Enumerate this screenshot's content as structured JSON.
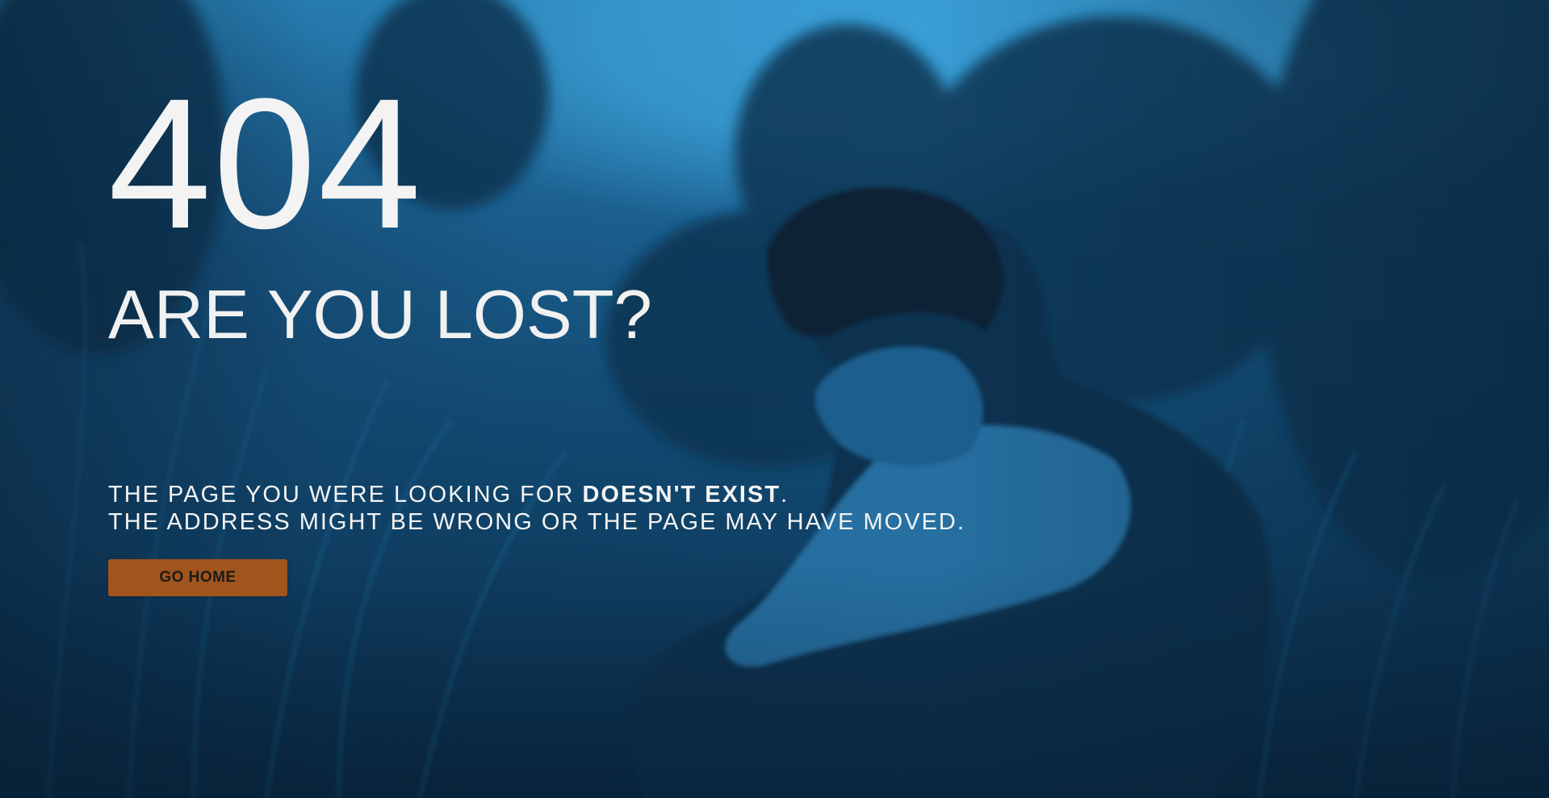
{
  "error": {
    "code": "404",
    "headline": "ARE YOU LOST?"
  },
  "message": {
    "line1_prefix": "THE PAGE YOU WERE LOOKING FOR ",
    "line1_emphasis": "DOESN'T EXIST",
    "line1_suffix": ".",
    "line2": "THE ADDRESS MIGHT BE WRONG OR THE PAGE MAY HAVE MOVED."
  },
  "actions": {
    "home_label": "GO HOME"
  },
  "colors": {
    "overlay_tint": "#1a6aa3",
    "button_background": "#a1541c",
    "text": "#f1f1f1"
  }
}
